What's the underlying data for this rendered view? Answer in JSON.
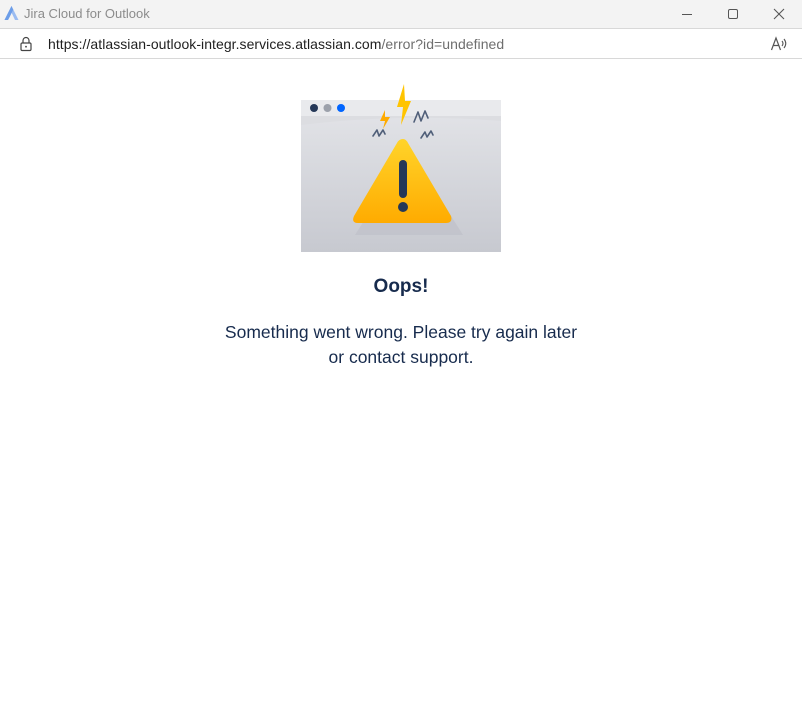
{
  "window": {
    "title": "Jira Cloud for Outlook",
    "app_icon": "jira-logo-icon",
    "controls": {
      "minimize_icon": "minimize-icon",
      "maximize_icon": "maximize-icon",
      "close_icon": "close-icon"
    }
  },
  "address_bar": {
    "lock_icon": "lock-icon",
    "url_host": "https://atlassian-outlook-integr.services.atlassian.com",
    "url_path": "/error?id=undefined",
    "read_aloud_icon": "read-aloud-icon"
  },
  "error_page": {
    "illustration": "browser-warning-illustration",
    "heading": "Oops!",
    "message": "Something went wrong. Please try again later or contact support."
  },
  "colors": {
    "titlebar_bg": "#f3f3f3",
    "text_dark": "#172b4d",
    "warning_yellow": "#ffc400",
    "jira_blue": "#2684ff"
  }
}
